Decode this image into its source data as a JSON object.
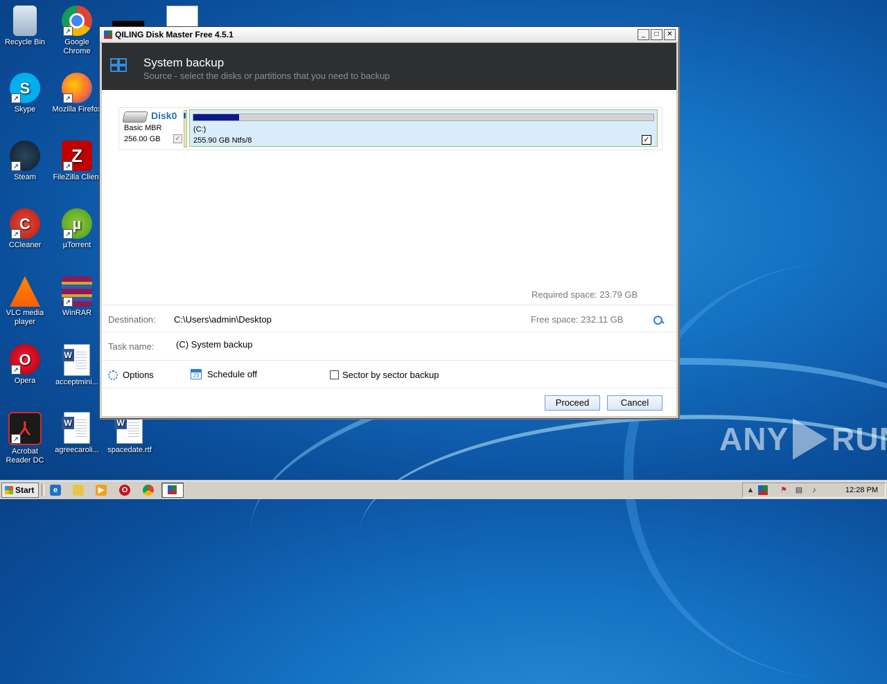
{
  "desktop": {
    "icons": [
      {
        "label": "Recycle Bin"
      },
      {
        "label": "Google Chrome"
      },
      {
        "label": "Skype"
      },
      {
        "label": "Mozilla Firefox"
      },
      {
        "label": "Steam"
      },
      {
        "label": "FileZilla Client"
      },
      {
        "label": "CCleaner"
      },
      {
        "label": "µTorrent"
      },
      {
        "label": "VLC media player"
      },
      {
        "label": "WinRAR"
      },
      {
        "label": "Opera"
      },
      {
        "label": "acceptmini..."
      },
      {
        "label": "Acrobat Reader DC"
      },
      {
        "label": "agreecaroli..."
      },
      {
        "label": "spacedate.rtf"
      }
    ]
  },
  "window": {
    "title": "QILING Disk Master Free 4.5.1",
    "buttons": {
      "minimize": "_",
      "maximize": "□",
      "close": "✕"
    }
  },
  "header": {
    "title": "System backup",
    "subtitle": "Source - select the disks or partitions that you need to backup"
  },
  "disk": {
    "name": "Disk0",
    "type": "Basic MBR",
    "size": "256.00 GB",
    "checked_mark": "✓",
    "partition": {
      "label": "(C:)",
      "info": "255.90 GB Ntfs/8",
      "used_fraction": 0.1,
      "checked_mark": "✓"
    }
  },
  "summary": {
    "required_space": "Required space: 23.79 GB",
    "destination_label": "Destination:",
    "destination_value": "C:\\Users\\admin\\Desktop",
    "free_space": "Free space: 232.11 GB",
    "task_label": "Task name:",
    "task_value": "(C) System backup"
  },
  "options": {
    "options_label": "Options",
    "schedule_label": "Schedule off",
    "schedule_day": "23",
    "sector_label": "Sector by sector backup"
  },
  "actions": {
    "proceed": "Proceed",
    "cancel": "Cancel"
  },
  "taskbar": {
    "start": "Start",
    "clock": "12:28 PM"
  },
  "watermark": {
    "left": "ANY",
    "right": "RUN"
  }
}
